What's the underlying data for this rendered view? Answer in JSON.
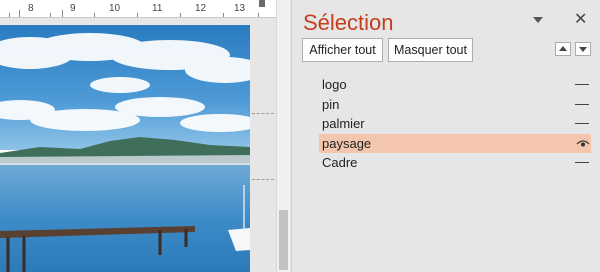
{
  "ruler": {
    "numbers": [
      "8",
      "9",
      "10",
      "11",
      "12",
      "13"
    ]
  },
  "pane": {
    "title": "Sélection",
    "close_glyph": "✕",
    "show_all_label": "Afficher tout",
    "hide_all_label": "Masquer tout",
    "menu_icon": "dropdown-arrow-icon",
    "move_up_icon": "move-up-icon",
    "move_down_icon": "move-down-icon"
  },
  "selection_list": {
    "items": [
      {
        "label": "logo",
        "visibility_icon": "hidden-dash-icon",
        "selected": false
      },
      {
        "label": "pin",
        "visibility_icon": "hidden-dash-icon",
        "selected": false
      },
      {
        "label": "palmier",
        "visibility_icon": "hidden-dash-icon",
        "selected": false
      },
      {
        "label": "paysage",
        "visibility_icon": "eye-icon",
        "selected": true
      },
      {
        "label": "Cadre",
        "visibility_icon": "hidden-dash-icon",
        "selected": false
      }
    ]
  },
  "colors": {
    "title_accent": "#c43e1c",
    "selected_row": "#f4c6ae",
    "pane_background": "#e6e6e6"
  }
}
